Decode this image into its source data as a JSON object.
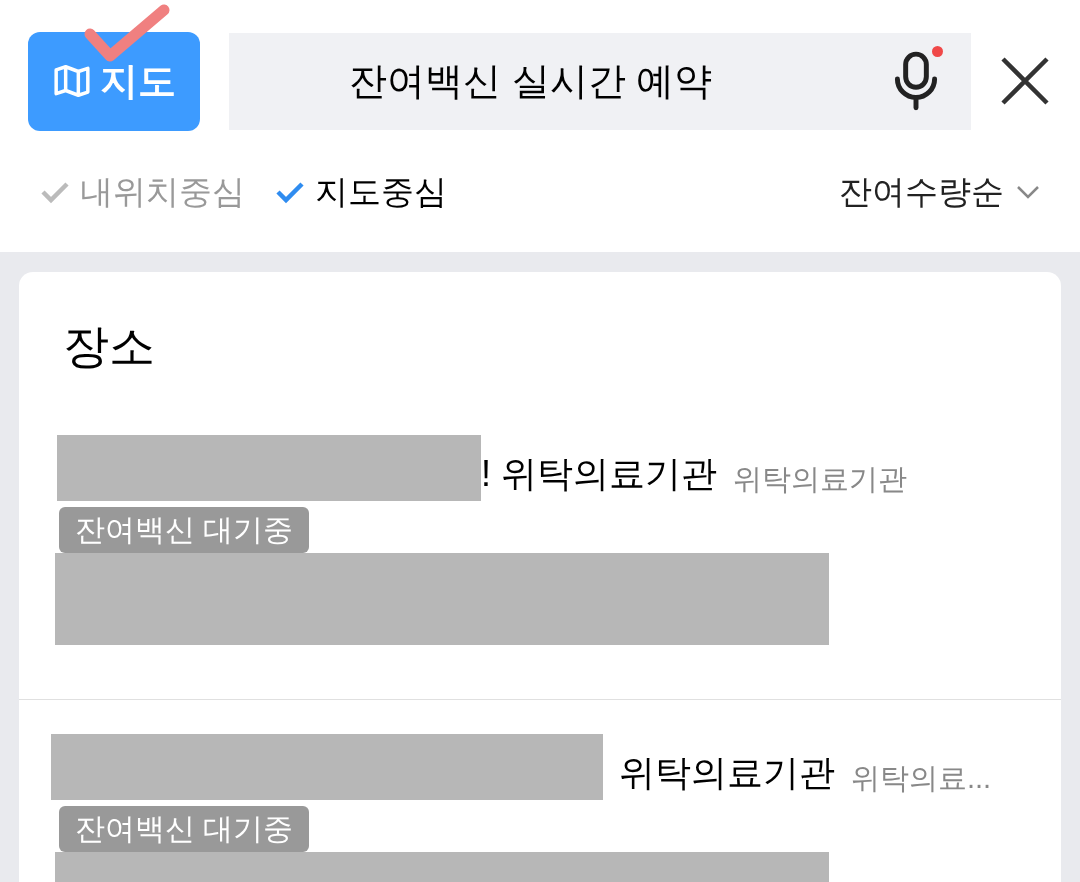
{
  "map_button": {
    "label": "지도"
  },
  "search": {
    "value": "잔여백신 실시간 예약",
    "mic_recording": true
  },
  "filters": [
    {
      "label": "내위치중심",
      "selected": false
    },
    {
      "label": "지도중심",
      "selected": true
    }
  ],
  "sort": {
    "label": "잔여수량순"
  },
  "section": {
    "title": "장소"
  },
  "places": [
    {
      "name": "! 위탁의료기관",
      "category": "위탁의료기관",
      "tag": "잔여백신 대기중"
    },
    {
      "name": "위탁의료기관",
      "category": "위탁의료...",
      "tag": "잔여백신 대기중"
    }
  ]
}
